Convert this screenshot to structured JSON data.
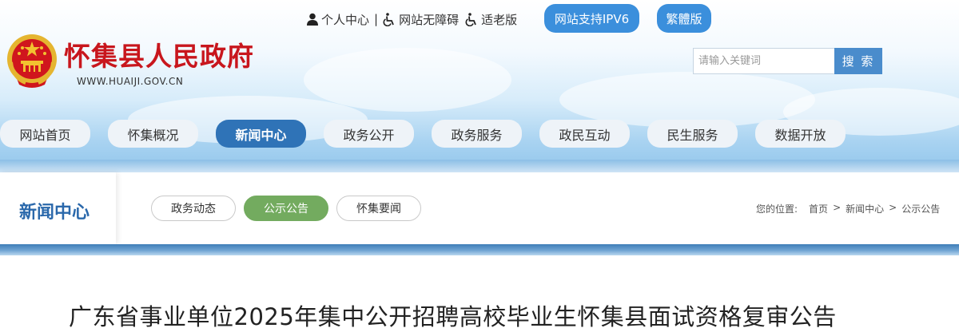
{
  "top_links": {
    "personal": "个人中心",
    "sep": "|",
    "accessible": "网站无障碍",
    "elderly": "适老版"
  },
  "top_buttons": {
    "ipv6": "网站支持IPV6",
    "traditional": "繁體版"
  },
  "site": {
    "title": "怀集县人民政府",
    "url": "WWW.HUAIJI.GOV.CN"
  },
  "search": {
    "placeholder": "请输入关键词",
    "button": "搜 索"
  },
  "nav": {
    "items": [
      {
        "label": "网站首页"
      },
      {
        "label": "怀集概况"
      },
      {
        "label": "新闻中心"
      },
      {
        "label": "政务公开"
      },
      {
        "label": "政务服务"
      },
      {
        "label": "政民互动"
      },
      {
        "label": "民生服务"
      },
      {
        "label": "数据开放"
      }
    ],
    "active_index": 2
  },
  "section": {
    "title": "新闻中心",
    "tabs": [
      {
        "label": "政务动态"
      },
      {
        "label": "公示公告"
      },
      {
        "label": "怀集要闻"
      }
    ],
    "active_tab": 1
  },
  "breadcrumb": {
    "prefix": "您的位置:",
    "items": [
      "首页",
      "新闻中心",
      "公示公告"
    ],
    "sep": ">"
  },
  "article": {
    "title": "广东省事业单位2025年集中公开招聘高校毕业生怀集县面试资格复审公告"
  },
  "colors": {
    "accent_blue": "#2f73b7",
    "title_red": "#c8161d",
    "tab_green": "#73ab5f"
  }
}
